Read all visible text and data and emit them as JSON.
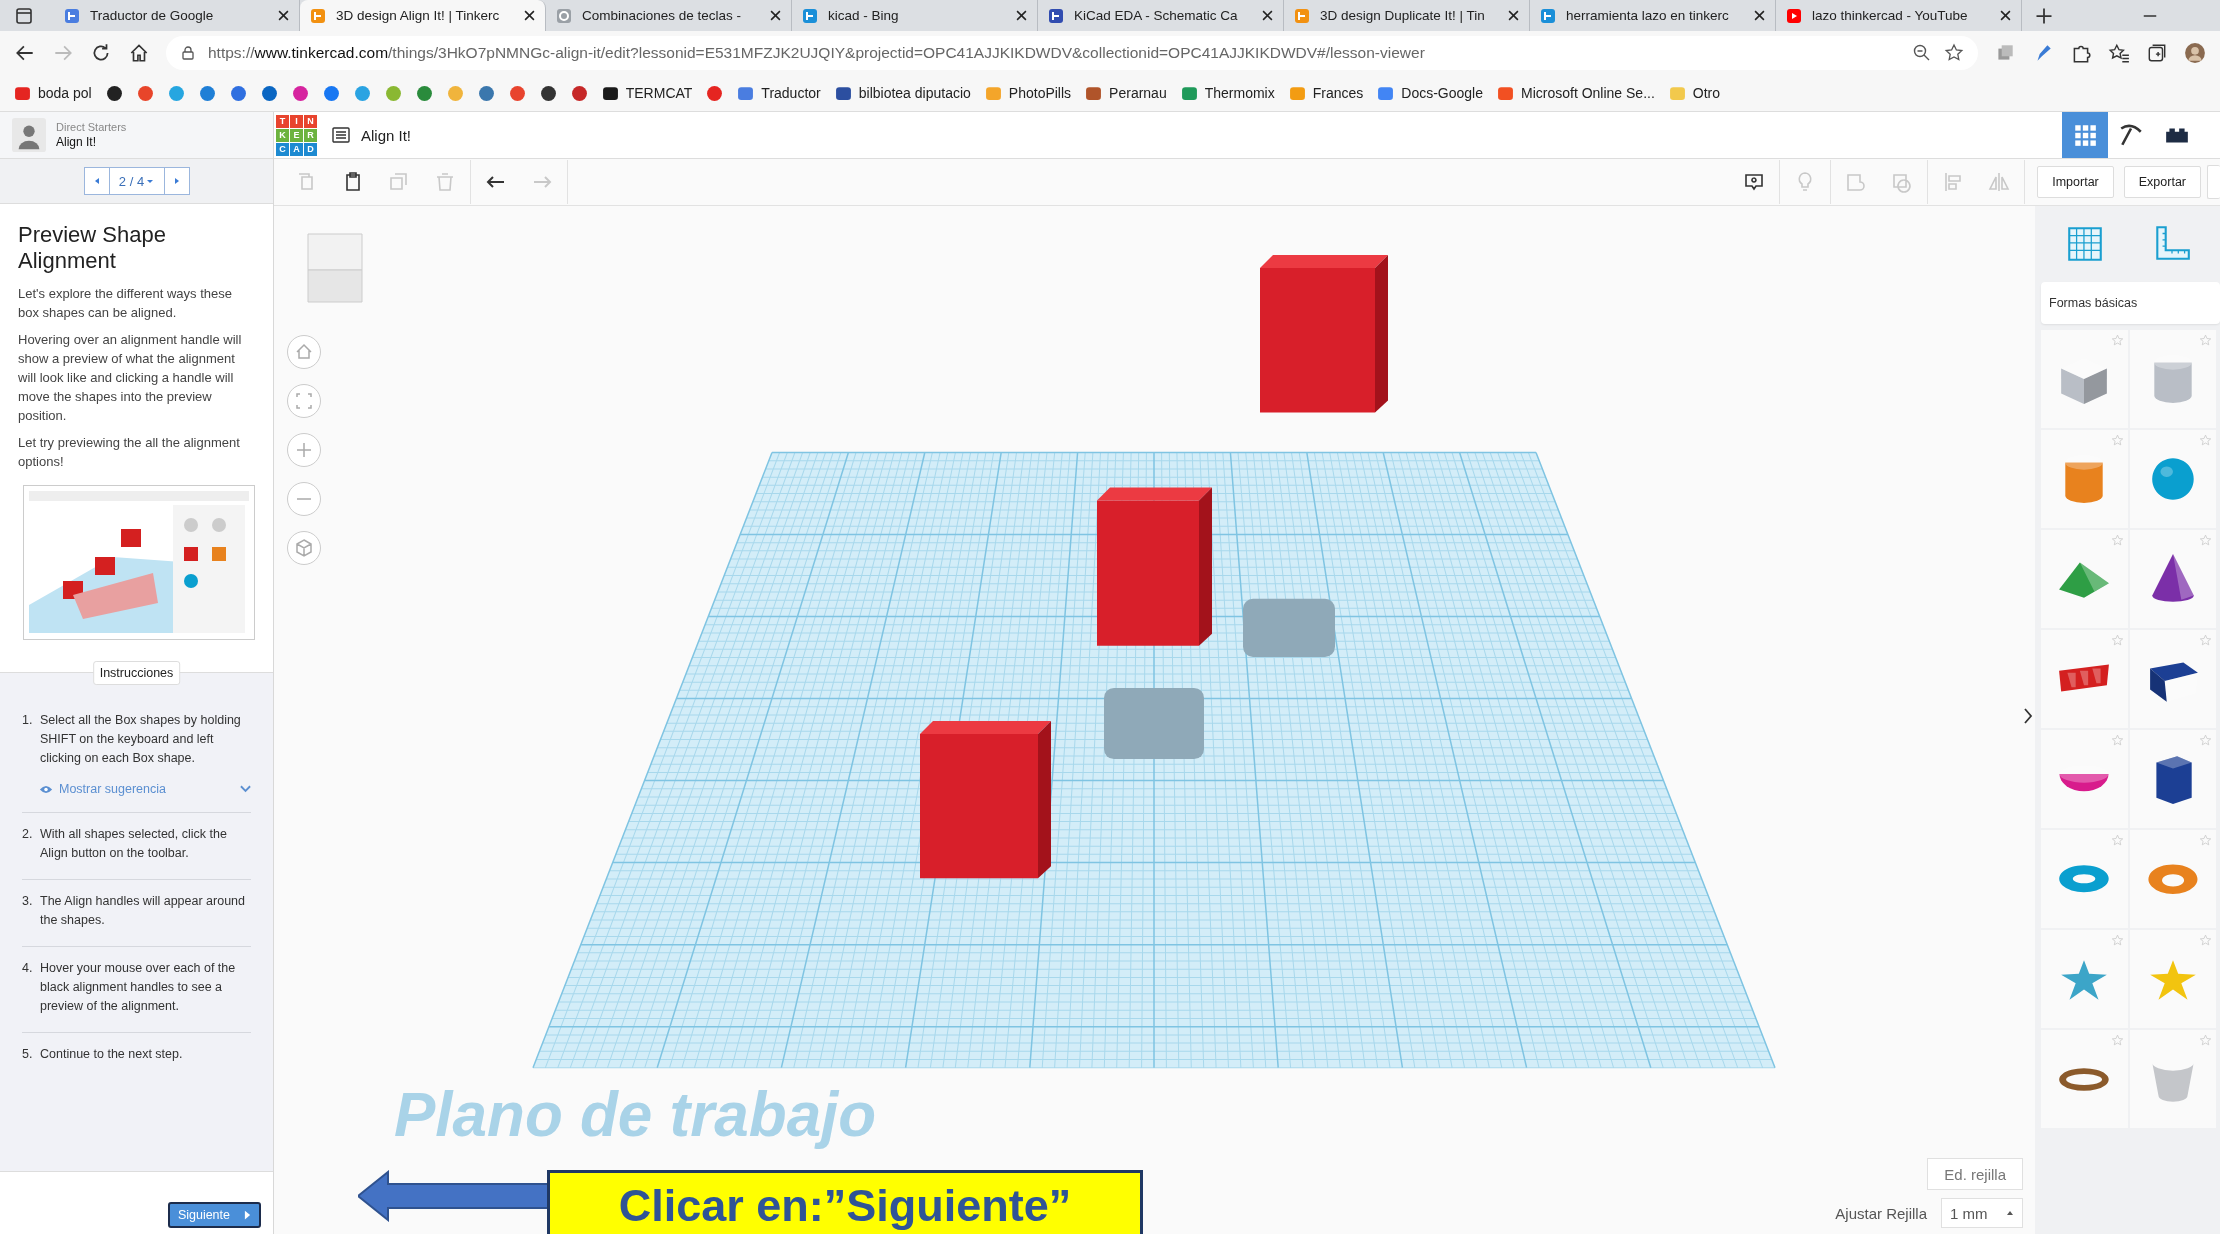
{
  "browser": {
    "tabs": [
      {
        "title": "Traductor de Google",
        "selected": false
      },
      {
        "title": "3D design Align It! | Tinkerc",
        "selected": true
      },
      {
        "title": "Combinaciones de teclas -",
        "selected": false
      },
      {
        "title": "kicad - Bing",
        "selected": false
      },
      {
        "title": "KiCad EDA - Schematic Ca",
        "selected": false
      },
      {
        "title": "3D design Duplicate It! | Tin",
        "selected": false
      },
      {
        "title": "herramienta lazo en tinkerc",
        "selected": false
      },
      {
        "title": "lazo thinkercad - YouTube",
        "selected": false
      }
    ],
    "url": {
      "scheme": "https://",
      "host": "www.tinkercad.com",
      "path": "/things/3HkO7pNMNGc-align-it/edit?lessonid=E531MFZJK2UJQIY&projectid=OPC41AJJKIKDWDV&collectionid=OPC41AJJKIKDWDV#/lesson-viewer"
    },
    "bookmarks": [
      {
        "label": "boda pol",
        "color": "#e52521"
      },
      {
        "color": "#222222"
      },
      {
        "color": "#e8452a"
      },
      {
        "color": "#26a6e0"
      },
      {
        "color": "#1f7fd6"
      },
      {
        "color": "#2f6fe0"
      },
      {
        "color": "#0a66c2"
      },
      {
        "color": "#d6249f"
      },
      {
        "color": "#1877f2"
      },
      {
        "color": "#2aa3e2"
      },
      {
        "color": "#8ab832"
      },
      {
        "color": "#2a8b3c"
      },
      {
        "color": "#f0b43c"
      },
      {
        "color": "#3b77ad"
      },
      {
        "color": "#e8442e"
      },
      {
        "color": "#333333"
      },
      {
        "color": "#c62828"
      },
      {
        "label": "TERMCAT",
        "color": "#1a1a1a"
      },
      {
        "color": "#e52521"
      },
      {
        "label": "Traductor",
        "color": "#4a7de0"
      },
      {
        "label": "bilbiotea diputacio",
        "color": "#2c4fa0"
      },
      {
        "label": "PhotoPills",
        "color": "#f4a52a"
      },
      {
        "label": "Perarnau",
        "color": "#b0542a"
      },
      {
        "label": "Thermomix",
        "color": "#1f9a5a"
      },
      {
        "label": "Frances",
        "color": "#f39c12"
      },
      {
        "label": "Docs-Google",
        "color": "#4285f4"
      },
      {
        "label": "Microsoft Online Se...",
        "color": "#f25022"
      },
      {
        "label": "Otro",
        "color": "#f2c94c"
      }
    ]
  },
  "app": {
    "project": {
      "group": "Direct Starters",
      "name": "Align It!"
    },
    "logo_letters": [
      "T",
      "I",
      "N",
      "K",
      "E",
      "R",
      "C",
      "A",
      "D"
    ],
    "design_title": "Align It!",
    "view_modes": [
      {
        "kind": "grid",
        "selected": true
      },
      {
        "kind": "pickaxe",
        "selected": false
      },
      {
        "kind": "brick",
        "selected": false
      }
    ],
    "pager": {
      "label": "2 / 4"
    },
    "lesson": {
      "title": "Preview Shape Alignment",
      "paragraphs": [
        "Let's explore the different ways these box shapes can be aligned.",
        "Hovering over an alignment handle will show a preview of what the alignment will look like and clicking a handle will move the shapes into the preview position.",
        "Let try previewing the all the alignment options!"
      ]
    },
    "instructions": {
      "tab": "Instrucciones",
      "steps": [
        {
          "number": "1.",
          "text": "Select all the Box shapes by holding SHIFT on the keyboard and left clicking on each Box shape.",
          "hint": {
            "label": "Mostrar sugerencia",
            "expanded": false
          }
        },
        {
          "number": "2.",
          "text": "With all shapes selected, click the Align button on the toolbar."
        },
        {
          "number": "3.",
          "text": "The Align handles will appear around the shapes."
        },
        {
          "number": "4.",
          "text": "Hover your mouse over each of the black alignment handles to see a preview of the alignment."
        },
        {
          "number": "5.",
          "text": "Continue to the next step."
        }
      ]
    },
    "next_button": "Siguiente",
    "toolbar": {
      "edit_tools": [
        {
          "kind": "copy",
          "disabled": true
        },
        {
          "kind": "paste",
          "disabled": false
        },
        {
          "kind": "duplicate",
          "disabled": true
        },
        {
          "kind": "delete",
          "disabled": true
        }
      ],
      "history_tools": [
        {
          "kind": "undo",
          "disabled": false
        },
        {
          "kind": "redo",
          "disabled": true
        }
      ],
      "shape_tools": [
        {
          "kind": "note",
          "disabled": false
        },
        {
          "kind": "bulb",
          "disabled": true
        },
        {
          "kind": "group",
          "disabled": true
        },
        {
          "kind": "ungroup",
          "disabled": true
        },
        {
          "kind": "align",
          "disabled": true
        },
        {
          "kind": "mirror",
          "disabled": true
        }
      ],
      "buttons": [
        "Importar",
        "Exportar"
      ]
    },
    "shapes_panel": {
      "category": "Formas básicas",
      "shapes": [
        {
          "kind": "box",
          "color": "#b9bec6"
        },
        {
          "kind": "cylinder",
          "color": "#b9bec6"
        },
        {
          "kind": "cylinder",
          "color": "#e8821e"
        },
        {
          "kind": "sphere",
          "color": "#0a9fcf"
        },
        {
          "kind": "roof",
          "color": "#2e9e45"
        },
        {
          "kind": "cone",
          "color": "#7b2fa8"
        },
        {
          "kind": "text",
          "color": "#d42020"
        },
        {
          "kind": "wedge",
          "color": "#1c3f94"
        },
        {
          "kind": "halfsphere",
          "color": "#d81b8c"
        },
        {
          "kind": "prism",
          "color": "#1c3f94"
        },
        {
          "kind": "torus",
          "color": "#0a9fcf"
        },
        {
          "kind": "tube",
          "color": "#e8821e"
        },
        {
          "kind": "star",
          "color": "#3ca5c8"
        },
        {
          "kind": "star",
          "color": "#f2c40f"
        },
        {
          "kind": "ring",
          "color": "#8b5a2b"
        },
        {
          "kind": "paraboloid",
          "color": "#c4c6ca"
        }
      ]
    },
    "workplane": {
      "label": "Plano de trabajo",
      "edit_grid": "Ed. rejilla",
      "snap_label": "Ajustar Rejilla",
      "snap_value": "1 mm"
    },
    "annotation": {
      "text": "Clicar en:”Siguiente”"
    }
  }
}
